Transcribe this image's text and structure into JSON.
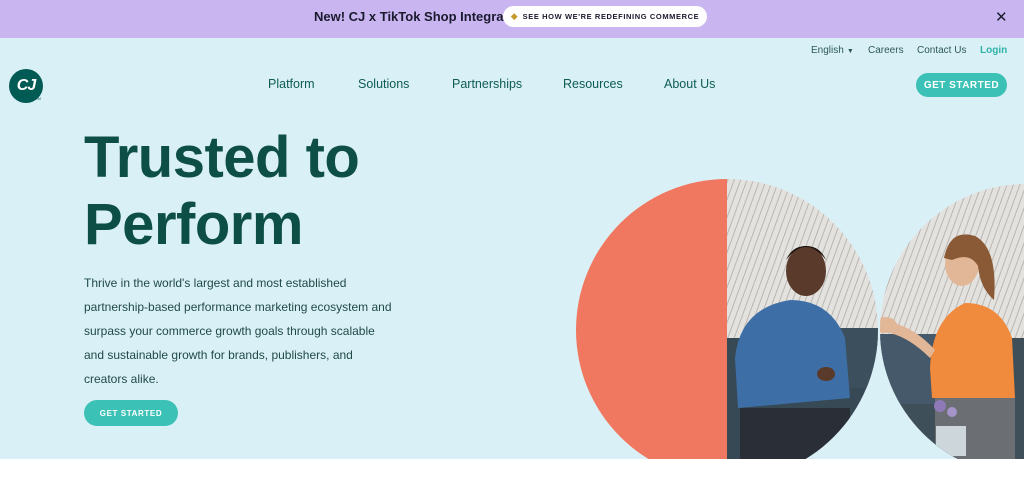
{
  "banner": {
    "text": "New! CJ x TikTok Shop Integration",
    "button_icon": "tag-icon",
    "button_label": "SEE HOW WE'RE REDEFINING COMMERCE",
    "close_icon": "close-icon"
  },
  "utility_nav": {
    "language": "English",
    "careers": "Careers",
    "contact": "Contact Us",
    "login": "Login"
  },
  "logo": {
    "text": "CJ",
    "tm": "TM"
  },
  "main_nav": {
    "items": [
      "Platform",
      "Solutions",
      "Partnerships",
      "Resources",
      "About Us"
    ],
    "cta": "GET STARTED"
  },
  "hero": {
    "headline_line1": "Trusted to",
    "headline_line2": "Perform",
    "body": "Thrive in the world's largest and most established partnership-based performance marketing ecosystem and surpass your commerce growth goals through scalable and sustainable growth for brands, publishers, and creators alike.",
    "cta": "GET STARTED"
  },
  "colors": {
    "banner_bg": "#c9b6f1",
    "hero_bg": "#daf0f7",
    "brand_teal": "#005b54",
    "accent_teal": "#3cc1b6",
    "coral": "#f07860"
  }
}
